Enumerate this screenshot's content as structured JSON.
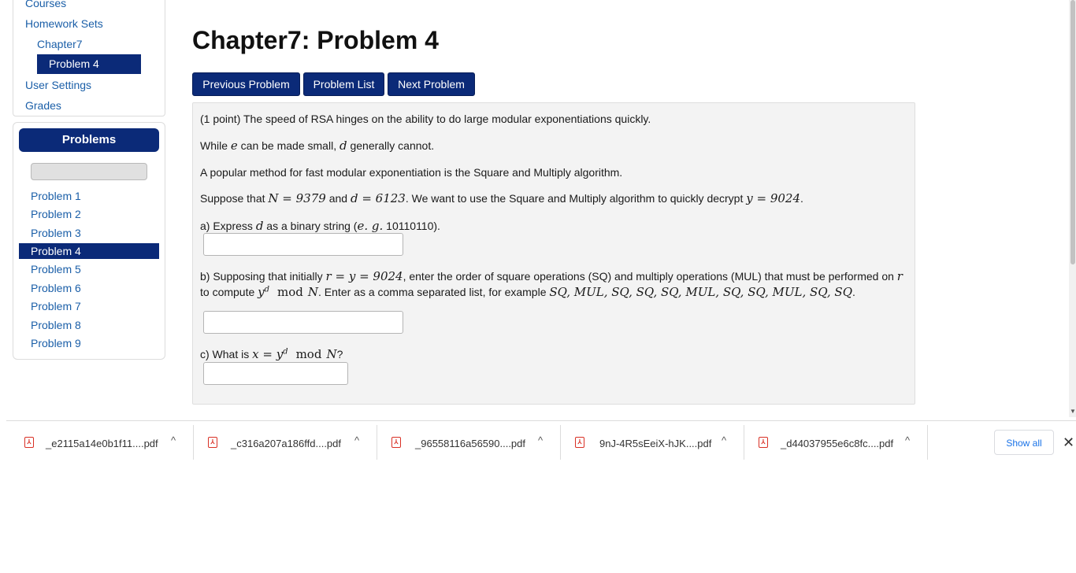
{
  "nav": {
    "courses": "Courses",
    "homework_sets": "Homework Sets",
    "chapter": "Chapter7",
    "problem": "Problem 4",
    "user_settings": "User Settings",
    "grades": "Grades"
  },
  "problems_panel": {
    "header": "Problems",
    "items": [
      "Problem 1",
      "Problem 2",
      "Problem 3",
      "Problem 4",
      "Problem 5",
      "Problem 6",
      "Problem 7",
      "Problem 8",
      "Problem 9"
    ],
    "active": "Problem 4"
  },
  "main": {
    "title": "Chapter7: Problem 4",
    "buttons": {
      "previous": "Previous Problem",
      "list": "Problem List",
      "next": "Next Problem"
    }
  },
  "problem": {
    "intro": "(1 point) The speed of RSA hinges on the ability to do large modular exponentiations quickly.",
    "l2_a": "While ",
    "l2_e": "e",
    "l2_b": " can be made small, ",
    "l2_d": "d",
    "l2_c": " generally cannot.",
    "l3": "A popular method for fast modular exponentiation is the Square and Multiply algorithm.",
    "l4_a": "Suppose that ",
    "l4_N": "N = 9379",
    "l4_b": " and ",
    "l4_d": "d = 6123",
    "l4_c": ". We want to use the Square and Multiply algorithm to quickly decrypt ",
    "l4_y": "y = 9024",
    "l4_end": ".",
    "a_1": "a) Express ",
    "a_d": "d",
    "a_2": " as a binary string (",
    "a_eg": "e. g.",
    "a_3": " 10110110).",
    "b_1": "b) Supposing that initially ",
    "b_ry": "r = y = 9024",
    "b_2": ", enter the order of square operations (SQ) and multiply operations (MUL) that must be performed on ",
    "b_r": "r",
    "b_3": "to compute ",
    "b_yd": "y",
    "b_sup": "d",
    "b_mod": "mod",
    "b_N": "N",
    "b_4": ". Enter as a comma separated list, for example ",
    "b_example": "SQ, MUL, SQ, SQ, SQ, MUL, SQ, SQ, MUL, SQ, SQ",
    "b_end": ".",
    "c_1": "c) What is ",
    "c_x": "x = y",
    "c_sup": "d",
    "c_mod": "mod",
    "c_N": "N",
    "c_end": "?",
    "answer_a": "",
    "answer_b": "",
    "answer_c": ""
  },
  "downloads": {
    "files": [
      "_e2115a14e0b1f11....pdf",
      "_c316a207a186ffd....pdf",
      "_96558116a56590....pdf",
      "9nJ-4R5sEeiX-hJK....pdf",
      "_d44037955e6c8fc....pdf"
    ],
    "show_all": "Show all",
    "pdf_glyph": "⅄",
    "chevron": "^",
    "close": "✕"
  },
  "icons": [
    "pdf-icon",
    "chevron-up-icon",
    "close-icon"
  ],
  "colors": {
    "accent": "#0b2a78",
    "link": "#1b5fa8",
    "panel": "#f3f3f3"
  }
}
